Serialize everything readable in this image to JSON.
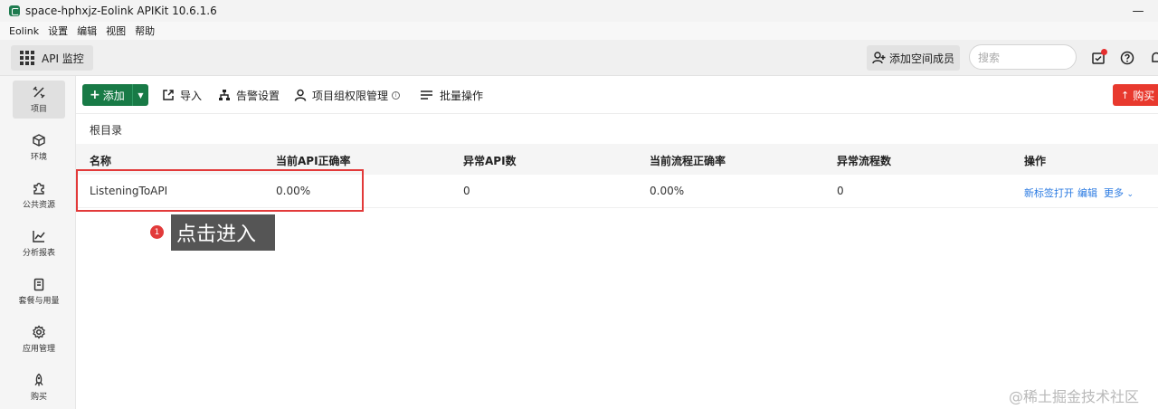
{
  "window": {
    "title": "space-hphxjz-Eolink APIKit 10.6.1.6"
  },
  "menu": [
    "Eolink",
    "设置",
    "编辑",
    "视图",
    "帮助"
  ],
  "header": {
    "module": "API 监控",
    "add_member": "添加空间成员",
    "search_placeholder": "搜索"
  },
  "sidebar": [
    {
      "label": "项目",
      "icon": "tools-icon",
      "active": true
    },
    {
      "label": "环境",
      "icon": "cube-icon"
    },
    {
      "label": "公共资源",
      "icon": "puzzle-icon"
    },
    {
      "label": "分析报表",
      "icon": "chart-icon"
    },
    {
      "label": "套餐与用量",
      "icon": "clipboard-icon"
    },
    {
      "label": "应用管理",
      "icon": "gear-icon"
    },
    {
      "label": "购买",
      "icon": "rocket-icon"
    }
  ],
  "toolbar": {
    "add": "添加",
    "import": "导入",
    "alert": "告警设置",
    "permission": "项目组权限管理",
    "batch": "批量操作",
    "buy": "购买"
  },
  "breadcrumb": "根目录",
  "table": {
    "headers": [
      "名称",
      "当前API正确率",
      "异常API数",
      "当前流程正确率",
      "异常流程数",
      "操作"
    ],
    "row": {
      "name": "ListeningToAPI",
      "api_rate": "0.00%",
      "api_errors": "0",
      "flow_rate": "0.00%",
      "flow_errors": "0",
      "actions": {
        "open": "新标签打开",
        "edit": "编辑",
        "more": "更多"
      }
    }
  },
  "annotation": {
    "step": "1",
    "text": "点击进入"
  },
  "watermark": "@稀土掘金技术社区",
  "colors": {
    "primary": "#187a46",
    "danger": "#e8392e",
    "link": "#2a7ae2",
    "annotation": "#e23a3a"
  }
}
